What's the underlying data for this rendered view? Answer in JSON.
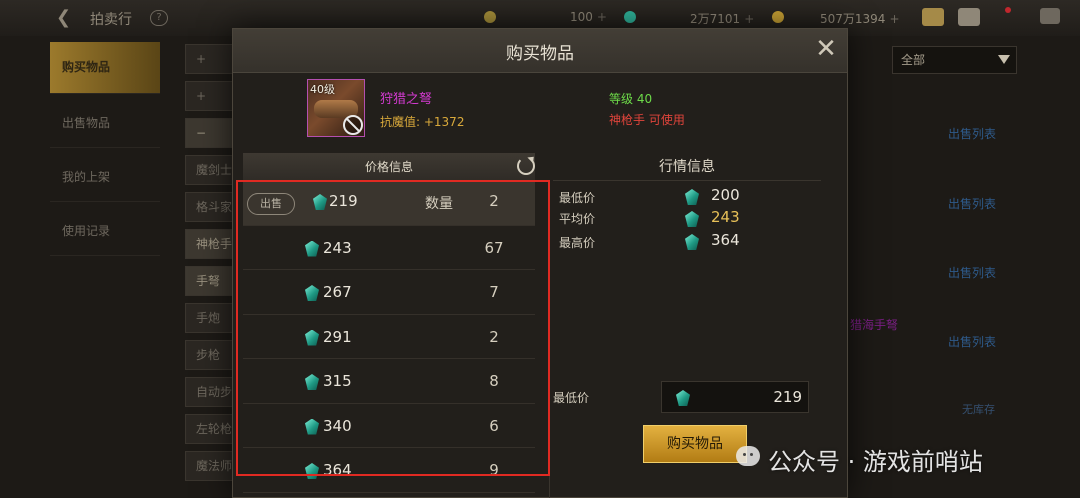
{
  "background": {
    "title": "拍卖行",
    "resources": [
      {
        "name": "moon-currency",
        "value": "100",
        "color": "#a8903a"
      },
      {
        "name": "gem-currency",
        "value": "2万7101",
        "color": "#2fb39a"
      },
      {
        "name": "gold-currency",
        "value": "507万1394",
        "color": "#c7a034"
      }
    ],
    "left_tabs": [
      "购买物品",
      "出售物品",
      "我的上架",
      "使用记录"
    ],
    "filters": [
      "+",
      "+",
      "−",
      "魔剑士",
      "格斗家",
      "神枪手",
      "手弩",
      "手炮",
      "步枪",
      "自动步枪",
      "左轮枪",
      "魔法师"
    ],
    "dropdown_value": "全部",
    "sell_list_label": "出售列表",
    "pink_item": "猎海手弩",
    "no_stock_label": "无库存"
  },
  "modal": {
    "title": "购买物品",
    "item": {
      "level_badge": "40级",
      "name": "狩猎之弩",
      "stat": "抗魔值: +1372",
      "req_level": "等级 40",
      "req_class": "神枪手 可使用"
    },
    "price_panel_title": "价格信息",
    "market_panel_title": "行情信息",
    "sell_badge": "出售",
    "qty_label": "数量",
    "price_rows": [
      {
        "price": "219",
        "qty": "2"
      },
      {
        "price": "243",
        "qty": "67"
      },
      {
        "price": "267",
        "qty": "7"
      },
      {
        "price": "291",
        "qty": "2"
      },
      {
        "price": "315",
        "qty": "8"
      },
      {
        "price": "340",
        "qty": "6"
      },
      {
        "price": "364",
        "qty": "9"
      }
    ],
    "market": {
      "min_label": "最低价",
      "min_value": "200",
      "avg_label": "平均价",
      "avg_value": "243",
      "max_label": "最高价",
      "max_value": "364"
    },
    "lowest_label": "最低价",
    "lowest_value": "219",
    "buy_button": "购买物品"
  },
  "watermark": "公众号 · 游戏前哨站",
  "colors": {
    "highlight": "#e02a22",
    "gem": "#2fb39a",
    "item_name": "#d33ad0",
    "avg_price": "#e7c058",
    "buy_button": "#d9a22e"
  }
}
